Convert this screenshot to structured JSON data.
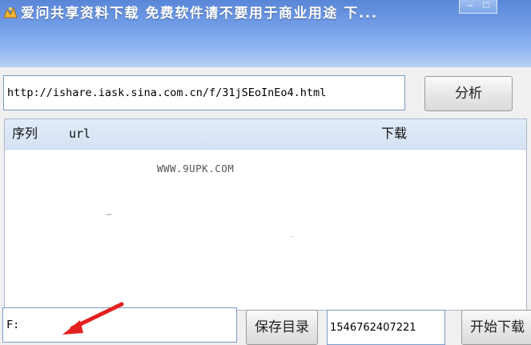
{
  "window": {
    "title": "爱问共享资料下载 免费软件请不要用于商业用途 下...",
    "minimize_glyph": "–",
    "maximize_glyph": "□",
    "titlebar_color": "#6f9be6"
  },
  "url_bar": {
    "value": "http://ishare.iask.sina.com.cn/f/31jSEoInEo4.html"
  },
  "analyze_button": {
    "label": "分析"
  },
  "list": {
    "columns": {
      "seq": "序列",
      "url": "url",
      "download": "下载"
    },
    "rows": [],
    "watermark": "WWW.9UPK.COM"
  },
  "bottom": {
    "save_path": "F:",
    "save_dir_button": "保存目录",
    "id_field": "1546762407221",
    "start_button": "开始下载"
  },
  "annotation": {
    "arrow_color": "#e52020"
  }
}
